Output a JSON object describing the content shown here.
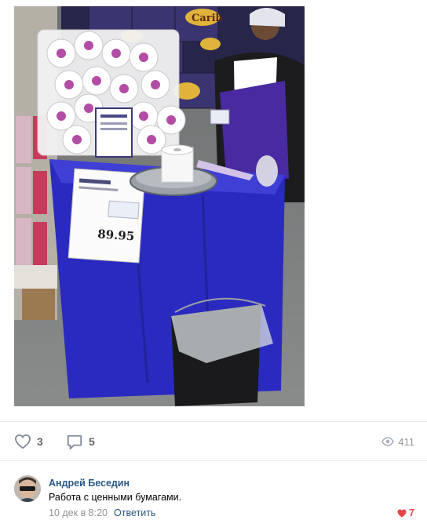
{
  "post": {
    "likes": "3",
    "comments": "5",
    "views": "411"
  },
  "comment": {
    "author": "Андрей Беседин",
    "text": "Работа с ценными бумагами.",
    "date": "10 дек в 8:20",
    "reply": "Ответить",
    "likes": "7"
  },
  "photo": {
    "brand_text": "Carib",
    "price_tag": "89.95"
  },
  "colors": {
    "link": "#2a5885",
    "muted": "#939393",
    "like_red": "#e64646"
  }
}
